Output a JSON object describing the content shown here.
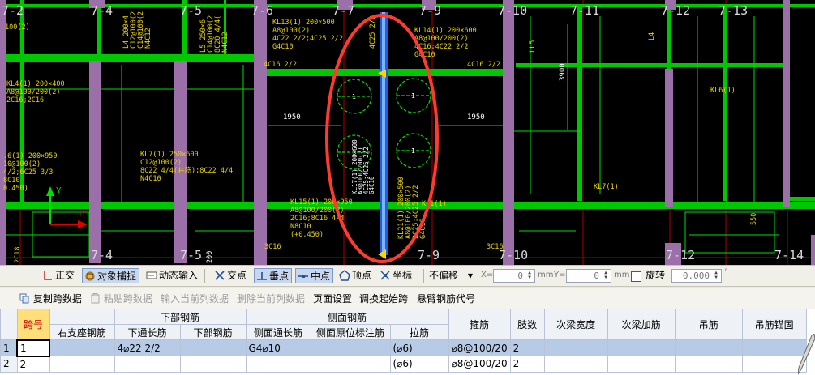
{
  "canvas": {
    "axis_labels": [
      "7-2",
      "7-4",
      "7-5",
      "7-6",
      "7-7",
      "7-9",
      "7-10",
      "7-11",
      "7-12",
      "7-13",
      "7-4",
      "7-5",
      "7-9",
      "7-10",
      "7-12",
      "7-14"
    ],
    "annotations": {
      "kl13": [
        "KL13(1) 200×500",
        "A8@100(2)",
        "4C22 2/2;4C25 2/2",
        "G4C10"
      ],
      "kl14": [
        "KL14(1) 200×600",
        "A8@100/200(2)",
        "4C16;4C22 2/2",
        "G4C10"
      ],
      "kl4": [
        "KL4(1) 200×400",
        "A8@100/200(2)",
        "2C16;2C16"
      ],
      "kl7": [
        "KL7(1) 250×600",
        "C12@100(2)",
        "8C22 4/4(井筋);8C22 4/4",
        "N4C10"
      ],
      "kl6_left": [
        ".6(1) 200×950",
        "10@100(2)",
        "4/2;6C25 3/3",
        "8C10",
        "0.450)"
      ],
      "kl15": [
        "KL15(1) 200×950",
        "A8@100/200(2)",
        "2C16;8C16 4/4",
        "N8C10",
        "(+0.450)"
      ],
      "l4": [
        "L4 200×4",
        "C12@100(2",
        "C14@100(2",
        "N4C12"
      ],
      "l5": [
        "L5 250×6",
        "C14@100(2",
        "8C20 4/4(",
        "N4C12"
      ],
      "dims": [
        "1950",
        "1950",
        "3900"
      ],
      "tops": [
        "4C25 2/2",
        "4C16 2/2",
        "4C16 2/2",
        "100(2)"
      ],
      "misc": [
        "KL1(1)",
        "KL6(1)",
        "KL7(1)",
        "LL5",
        "L4",
        "550",
        "3C16",
        "3C16",
        "2C18",
        "200"
      ],
      "vertical_beam": [
        "KL17(1) 200×600",
        "A8@100/200(2)",
        "4C25;4C25 2/2",
        "G4C10"
      ],
      "vertical_beam2": [
        "KL21(1) 200×500",
        "A8@100/200(2)",
        "2C25;4C25 2/2",
        "G4C10"
      ],
      "circle_marks": [
        "1",
        "1",
        "1",
        "1"
      ],
      "ucs": {
        "y": "Y",
        "x": "X"
      }
    }
  },
  "snap_bar": {
    "ortho": "正交",
    "object_snap": "对象捕捉",
    "dynamic_input": "动态输入",
    "intersection": "交点",
    "perpendicular": "垂点",
    "midpoint": "中点",
    "vertex": "顶点",
    "coordinate": "坐标",
    "offset_select": "不偏移",
    "x_label": "X=",
    "x_value": "0",
    "x_unit": "mm",
    "y_label": "Y=",
    "y_value": "0",
    "y_unit": "mm",
    "rotate_label": "旋转",
    "rotate_value": "0.000",
    "degree": "°"
  },
  "grid_toolbar": {
    "copy_span": "复制跨数据",
    "paste_span": "粘贴跨数据",
    "input_current": "输入当前列数据",
    "delete_current": "删除当前列数据",
    "page_setup": "页面设置",
    "swap_start": "调换起始跨",
    "cantilever": "悬臂钢筋代号"
  },
  "table": {
    "group_headers": {
      "bottom": "下部钢筋",
      "side": "侧面钢筋"
    },
    "headers": [
      "跨号",
      "右支座钢筋",
      "下通长筋",
      "下部钢筋",
      "侧面通长筋",
      "侧面原位标注筋",
      "拉筋",
      "箍筋",
      "肢数",
      "次梁宽度",
      "次梁加筋",
      "吊筋",
      "吊筋锚固"
    ],
    "rows": [
      {
        "index": "1",
        "span": "1",
        "right_support": "",
        "bottom_through": "4⌀22 2/2",
        "bottom": "",
        "side_through": "G4⌀10",
        "side_inplace": "",
        "tie": "(⌀6)",
        "stirrup": "⌀8@100/20",
        "legs": "2",
        "sub_width": "",
        "sub_add": "",
        "hanger": "",
        "hanger_anchor": ""
      },
      {
        "index": "2",
        "span": "2",
        "right_support": "",
        "bottom_through": "",
        "bottom": "",
        "side_through": "",
        "side_inplace": "",
        "tie": "(⌀6)",
        "stirrup": "⌀8@100/20",
        "legs": "2",
        "sub_width": "",
        "sub_add": "",
        "hanger": "",
        "hanger_anchor": ""
      }
    ]
  },
  "colors": {
    "beam_green": "#00c800",
    "column_purple": "#9b6fa8",
    "highlight_circle": "#ff3b30",
    "axis_line": "#d00000",
    "text_yellow": "#e8d400"
  }
}
